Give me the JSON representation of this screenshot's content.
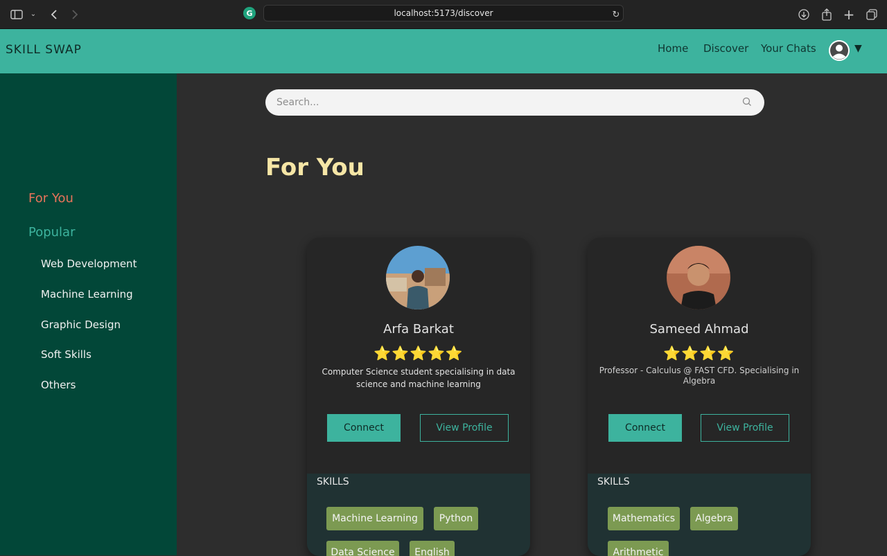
{
  "browser": {
    "url": "localhost:5173/discover"
  },
  "navbar": {
    "brand": "SKILL SWAP",
    "links": [
      "Home",
      "Discover",
      "Your Chats"
    ],
    "caret": "▼"
  },
  "sidebar": {
    "for_you": "For You",
    "popular": "Popular",
    "categories": [
      "Web Development",
      "Machine Learning",
      "Graphic Design",
      "Soft Skills",
      "Others"
    ]
  },
  "search": {
    "placeholder": "Search..."
  },
  "page_title": "For You",
  "cards": [
    {
      "name": "Arfa Barkat",
      "stars": "⭐⭐⭐⭐⭐",
      "rating": 5,
      "bio": "Computer Science student specialising in data science and machine learning",
      "connect_label": "Connect",
      "profile_label": "View Profile",
      "skills_title": "SKILLS",
      "skills": [
        "Machine Learning",
        "Python",
        "Data Science",
        "English"
      ]
    },
    {
      "name": "Sameed Ahmad",
      "stars": "⭐⭐⭐⭐",
      "rating": 4,
      "bio": "Professor - Calculus @ FAST CFD. Specialising in Algebra",
      "connect_label": "Connect",
      "profile_label": "View Profile",
      "skills_title": "SKILLS",
      "skills": [
        "Mathematics",
        "Algebra",
        "Arithmetic"
      ]
    }
  ],
  "colors": {
    "navbar": "#3db39e",
    "sidebar": "#024738",
    "main_bg": "#2d2d2d",
    "for_you_accent": "#e8735a",
    "popular_accent": "#3db39e",
    "title": "#f6e6a6",
    "skill_tag": "#7c9a52"
  }
}
